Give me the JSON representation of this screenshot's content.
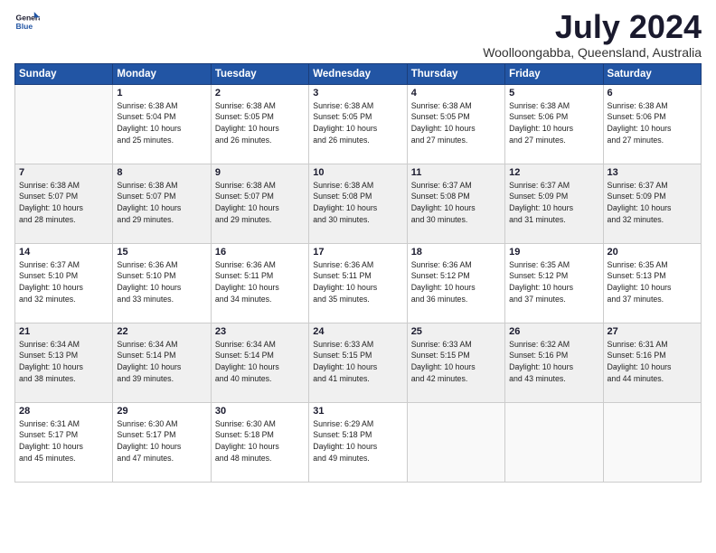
{
  "header": {
    "logo_line1": "General",
    "logo_line2": "Blue",
    "month_year": "July 2024",
    "location": "Woolloongabba, Queensland, Australia"
  },
  "weekdays": [
    "Sunday",
    "Monday",
    "Tuesday",
    "Wednesday",
    "Thursday",
    "Friday",
    "Saturday"
  ],
  "weeks": [
    [
      {
        "day": "",
        "info": ""
      },
      {
        "day": "1",
        "info": "Sunrise: 6:38 AM\nSunset: 5:04 PM\nDaylight: 10 hours\nand 25 minutes."
      },
      {
        "day": "2",
        "info": "Sunrise: 6:38 AM\nSunset: 5:05 PM\nDaylight: 10 hours\nand 26 minutes."
      },
      {
        "day": "3",
        "info": "Sunrise: 6:38 AM\nSunset: 5:05 PM\nDaylight: 10 hours\nand 26 minutes."
      },
      {
        "day": "4",
        "info": "Sunrise: 6:38 AM\nSunset: 5:05 PM\nDaylight: 10 hours\nand 27 minutes."
      },
      {
        "day": "5",
        "info": "Sunrise: 6:38 AM\nSunset: 5:06 PM\nDaylight: 10 hours\nand 27 minutes."
      },
      {
        "day": "6",
        "info": "Sunrise: 6:38 AM\nSunset: 5:06 PM\nDaylight: 10 hours\nand 27 minutes."
      }
    ],
    [
      {
        "day": "7",
        "info": "Sunrise: 6:38 AM\nSunset: 5:07 PM\nDaylight: 10 hours\nand 28 minutes."
      },
      {
        "day": "8",
        "info": "Sunrise: 6:38 AM\nSunset: 5:07 PM\nDaylight: 10 hours\nand 29 minutes."
      },
      {
        "day": "9",
        "info": "Sunrise: 6:38 AM\nSunset: 5:07 PM\nDaylight: 10 hours\nand 29 minutes."
      },
      {
        "day": "10",
        "info": "Sunrise: 6:38 AM\nSunset: 5:08 PM\nDaylight: 10 hours\nand 30 minutes."
      },
      {
        "day": "11",
        "info": "Sunrise: 6:37 AM\nSunset: 5:08 PM\nDaylight: 10 hours\nand 30 minutes."
      },
      {
        "day": "12",
        "info": "Sunrise: 6:37 AM\nSunset: 5:09 PM\nDaylight: 10 hours\nand 31 minutes."
      },
      {
        "day": "13",
        "info": "Sunrise: 6:37 AM\nSunset: 5:09 PM\nDaylight: 10 hours\nand 32 minutes."
      }
    ],
    [
      {
        "day": "14",
        "info": "Sunrise: 6:37 AM\nSunset: 5:10 PM\nDaylight: 10 hours\nand 32 minutes."
      },
      {
        "day": "15",
        "info": "Sunrise: 6:36 AM\nSunset: 5:10 PM\nDaylight: 10 hours\nand 33 minutes."
      },
      {
        "day": "16",
        "info": "Sunrise: 6:36 AM\nSunset: 5:11 PM\nDaylight: 10 hours\nand 34 minutes."
      },
      {
        "day": "17",
        "info": "Sunrise: 6:36 AM\nSunset: 5:11 PM\nDaylight: 10 hours\nand 35 minutes."
      },
      {
        "day": "18",
        "info": "Sunrise: 6:36 AM\nSunset: 5:12 PM\nDaylight: 10 hours\nand 36 minutes."
      },
      {
        "day": "19",
        "info": "Sunrise: 6:35 AM\nSunset: 5:12 PM\nDaylight: 10 hours\nand 37 minutes."
      },
      {
        "day": "20",
        "info": "Sunrise: 6:35 AM\nSunset: 5:13 PM\nDaylight: 10 hours\nand 37 minutes."
      }
    ],
    [
      {
        "day": "21",
        "info": "Sunrise: 6:34 AM\nSunset: 5:13 PM\nDaylight: 10 hours\nand 38 minutes."
      },
      {
        "day": "22",
        "info": "Sunrise: 6:34 AM\nSunset: 5:14 PM\nDaylight: 10 hours\nand 39 minutes."
      },
      {
        "day": "23",
        "info": "Sunrise: 6:34 AM\nSunset: 5:14 PM\nDaylight: 10 hours\nand 40 minutes."
      },
      {
        "day": "24",
        "info": "Sunrise: 6:33 AM\nSunset: 5:15 PM\nDaylight: 10 hours\nand 41 minutes."
      },
      {
        "day": "25",
        "info": "Sunrise: 6:33 AM\nSunset: 5:15 PM\nDaylight: 10 hours\nand 42 minutes."
      },
      {
        "day": "26",
        "info": "Sunrise: 6:32 AM\nSunset: 5:16 PM\nDaylight: 10 hours\nand 43 minutes."
      },
      {
        "day": "27",
        "info": "Sunrise: 6:31 AM\nSunset: 5:16 PM\nDaylight: 10 hours\nand 44 minutes."
      }
    ],
    [
      {
        "day": "28",
        "info": "Sunrise: 6:31 AM\nSunset: 5:17 PM\nDaylight: 10 hours\nand 45 minutes."
      },
      {
        "day": "29",
        "info": "Sunrise: 6:30 AM\nSunset: 5:17 PM\nDaylight: 10 hours\nand 47 minutes."
      },
      {
        "day": "30",
        "info": "Sunrise: 6:30 AM\nSunset: 5:18 PM\nDaylight: 10 hours\nand 48 minutes."
      },
      {
        "day": "31",
        "info": "Sunrise: 6:29 AM\nSunset: 5:18 PM\nDaylight: 10 hours\nand 49 minutes."
      },
      {
        "day": "",
        "info": ""
      },
      {
        "day": "",
        "info": ""
      },
      {
        "day": "",
        "info": ""
      }
    ]
  ]
}
